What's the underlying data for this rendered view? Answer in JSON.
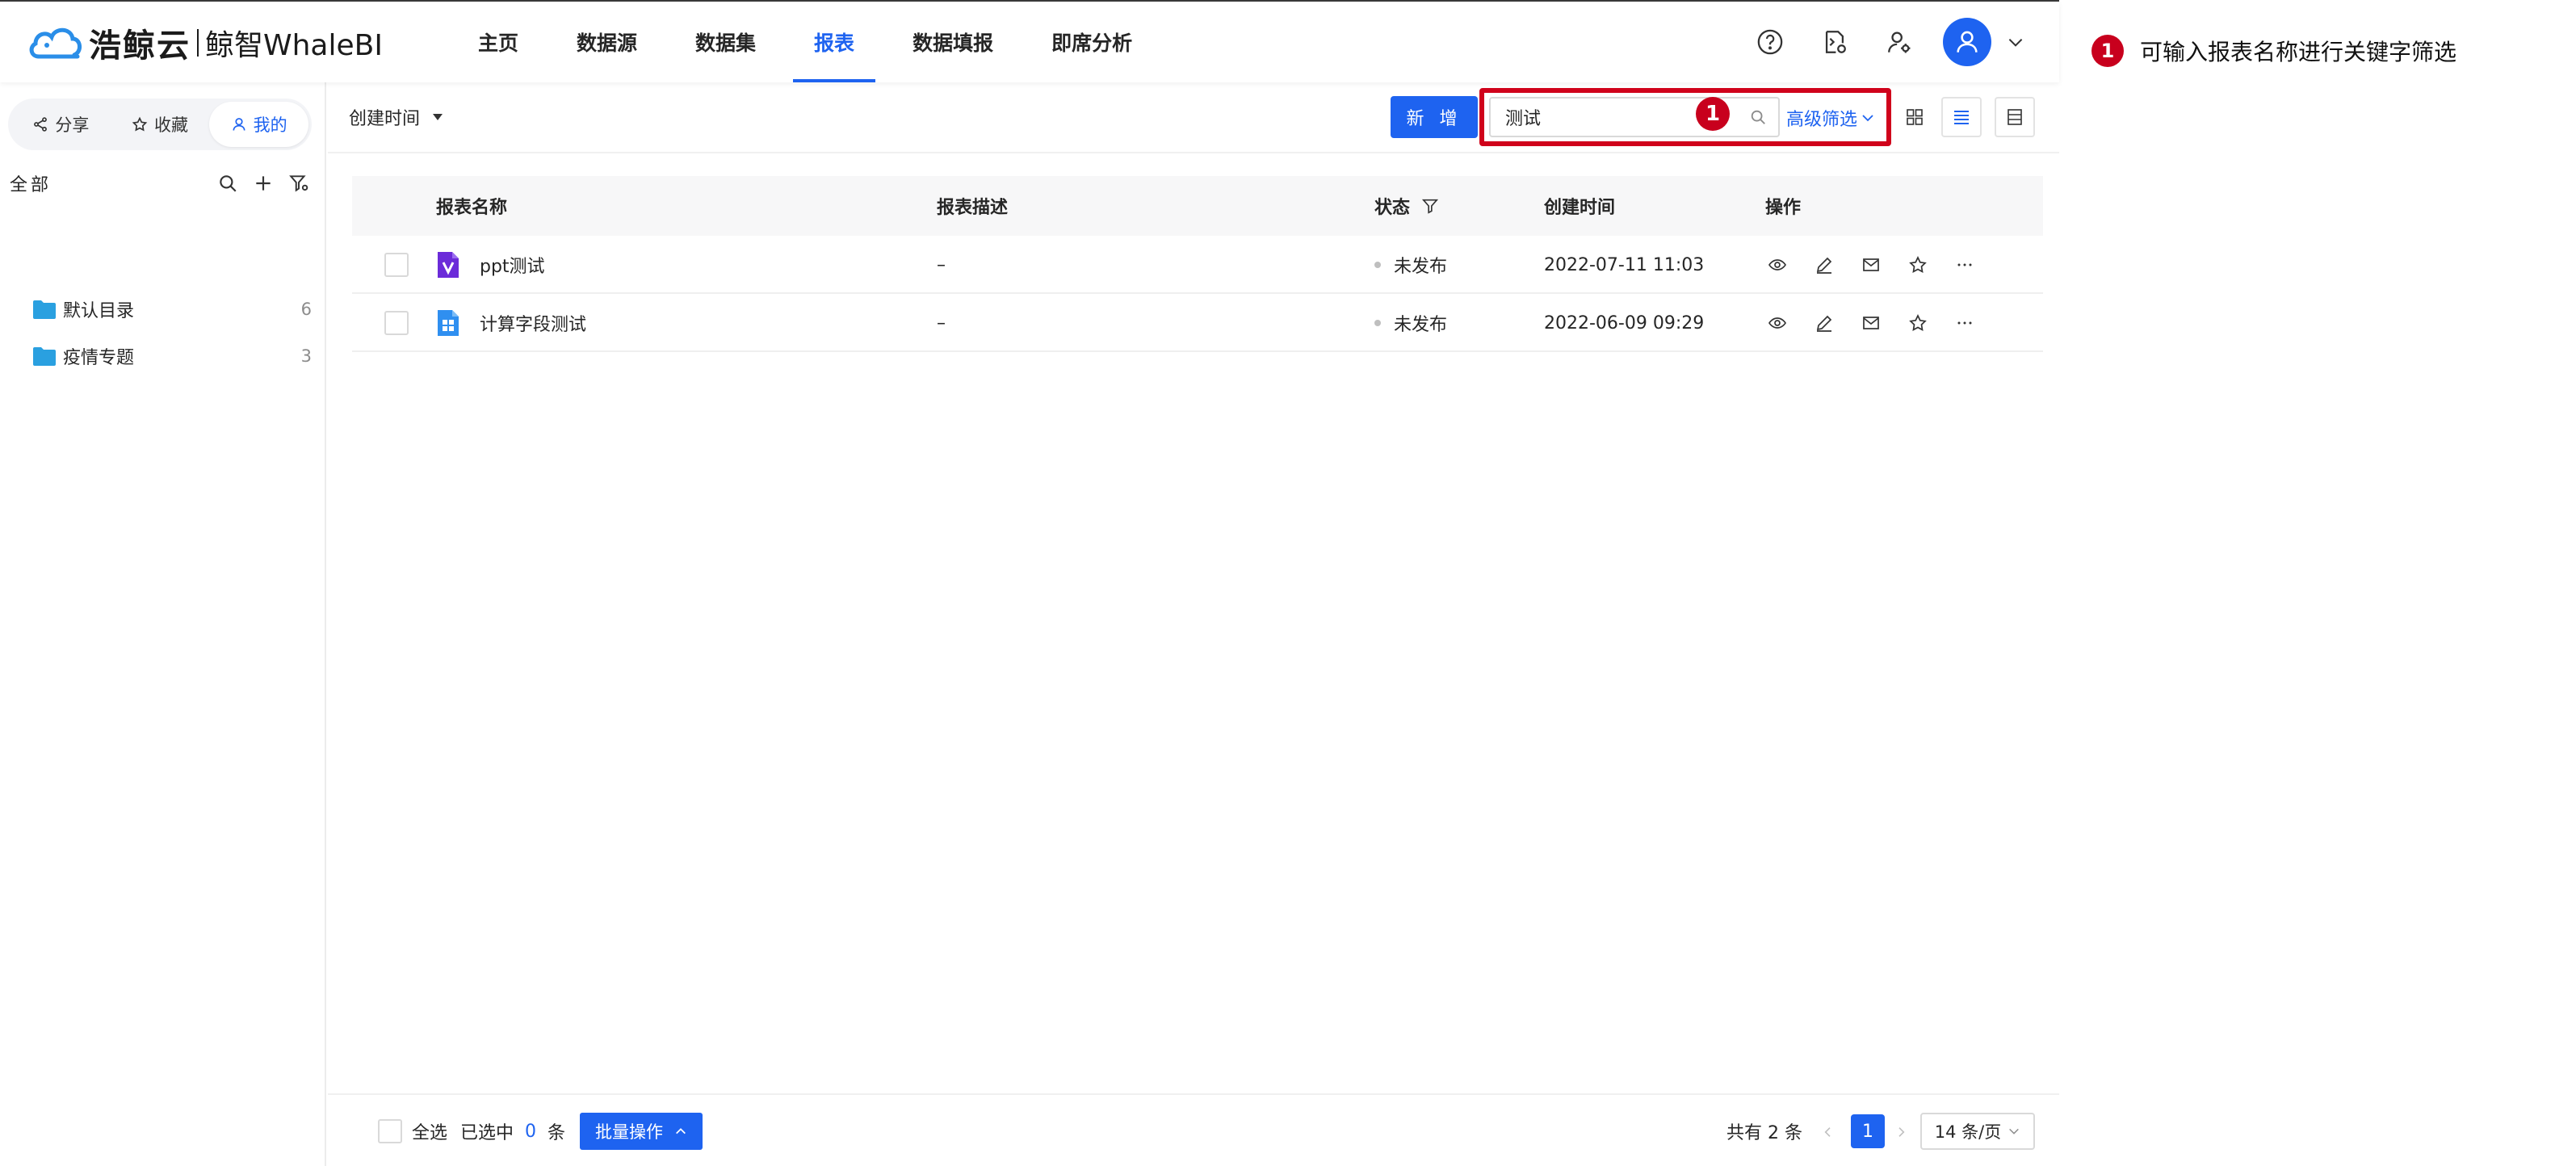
{
  "header": {
    "logo_cn": "浩鲸云",
    "logo_en": "鲸智WhaleBI",
    "nav": [
      "主页",
      "数据源",
      "数据集",
      "报表",
      "数据填报",
      "即席分析"
    ],
    "active_nav": "报表"
  },
  "sidebar": {
    "tabs": [
      {
        "label": "分享",
        "icon": "share-icon"
      },
      {
        "label": "收藏",
        "icon": "star-icon"
      },
      {
        "label": "我的",
        "icon": "user-icon",
        "active": true
      }
    ],
    "tree_title": "全部",
    "folders": [
      {
        "name": "默认目录",
        "count": "6"
      },
      {
        "name": "疫情专题",
        "count": "3"
      }
    ]
  },
  "toolbar": {
    "sort_label": "创建时间",
    "new_label": "新 增",
    "search_value": "测试",
    "advanced_filter": "高级筛选",
    "highlight_badge": "1"
  },
  "table": {
    "columns": [
      "报表名称",
      "报表描述",
      "状态",
      "创建时间",
      "操作"
    ],
    "rows": [
      {
        "name": "ppt测试",
        "desc": "–",
        "status": "未发布",
        "created": "2022-07-11 11:03",
        "type": "ppt"
      },
      {
        "name": "计算字段测试",
        "desc": "–",
        "status": "未发布",
        "created": "2022-06-09 09:29",
        "type": "dashboard"
      }
    ]
  },
  "footer": {
    "select_all": "全选",
    "selected_prefix": "已选中",
    "selected_count": "0",
    "selected_suffix": "条",
    "batch_label": "批量操作",
    "total_text": "共有 2 条",
    "current_page": "1",
    "page_size": "14 条/页"
  },
  "annotation": {
    "badge": "1",
    "text": "可输入报表名称进行关键字筛选"
  },
  "colors": {
    "primary": "#1e63f0",
    "highlight": "#d0021b",
    "folder": "#2aa0e0"
  }
}
